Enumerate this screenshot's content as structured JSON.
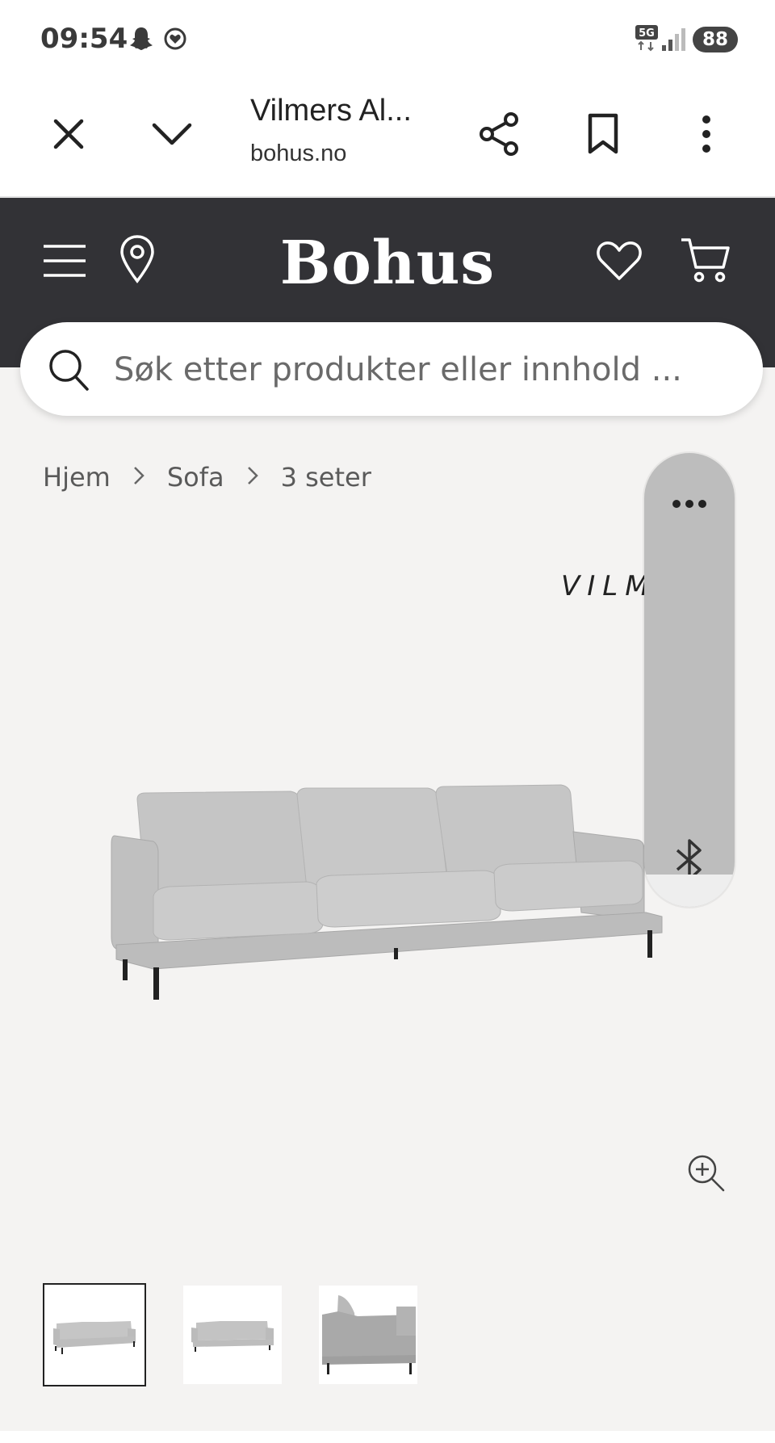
{
  "status_bar": {
    "time": "09:54",
    "notification_icons": [
      "snapchat-icon",
      "heart-circle-icon"
    ],
    "network": "5G",
    "signal_icon": "signal-bars-icon",
    "battery": "88"
  },
  "browser": {
    "close_icon": "close-icon",
    "menu_collapse_icon": "chevron-down-icon",
    "title": "Vilmers Al...",
    "domain": "bohus.no",
    "share_icon": "share-icon",
    "bookmark_icon": "bookmark-icon",
    "more_icon": "more-vertical-icon"
  },
  "site_header": {
    "logo": "Bohus",
    "background": "#323236",
    "icons": [
      "menu-icon",
      "location-pin-icon",
      "heart-icon",
      "cart-icon"
    ]
  },
  "search": {
    "placeholder": "Søk etter produkter eller innhold ..."
  },
  "breadcrumb": {
    "items": [
      "Hjem",
      "Sofa",
      "3 seter"
    ]
  },
  "product": {
    "brand_mark": "VILM",
    "image": "grey 3-seat sofa",
    "zoom_icon": "zoom-in-icon"
  },
  "floating_overlay": {
    "more_icon": "more-horizontal-icon",
    "bluetooth_icon": "bluetooth-icon"
  },
  "thumbnails": [
    {
      "label": "sofa-front",
      "active": true
    },
    {
      "label": "sofa-front-2",
      "active": false
    },
    {
      "label": "sofa-side",
      "active": false
    }
  ]
}
